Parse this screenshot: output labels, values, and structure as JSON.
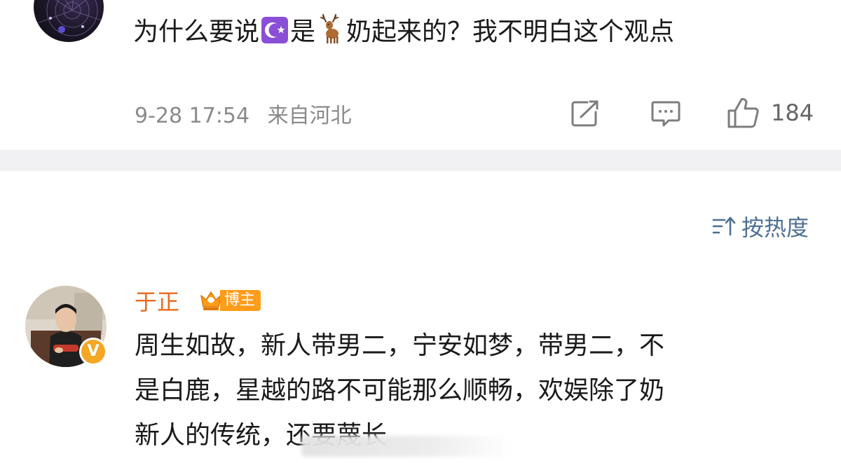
{
  "post": {
    "text_before": "为什么要说",
    "text_middle": "是",
    "text_after": "奶起来的？我不明白这个观点",
    "emoji_1": "star-and-crescent-emoji",
    "emoji_2": "deer-emoji",
    "timestamp": "9-28 17:54",
    "location": "来自河北",
    "like_count": "184",
    "icons": [
      "share-icon",
      "comment-icon",
      "like-icon"
    ]
  },
  "sort": {
    "label": "按热度",
    "icon": "sort-icon"
  },
  "comment": {
    "author": "于正",
    "badge": "博主",
    "badge_icon": "crown-icon",
    "verified_icon": "v-badge",
    "verified_letter": "V",
    "lines": [
      "周生如故，新人带男二，宁安如梦，带男二，不",
      "是白鹿，星越的路不可能那么顺畅，欢娱除了奶",
      "新人的传统，还要蔑长"
    ]
  },
  "colors": {
    "author_name": "#e86a1c",
    "sort_link": "#4e6f94",
    "meta_gray": "#8a8a8a",
    "divider": "#f1f1f3",
    "badge_orange": "#ff9c1a"
  }
}
